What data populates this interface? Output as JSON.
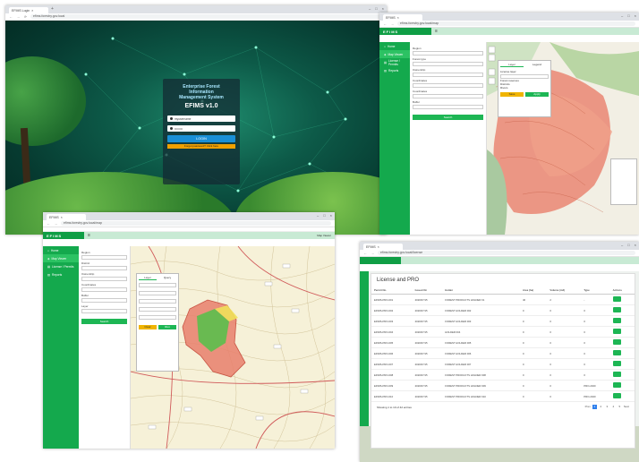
{
  "windows": {
    "login": {
      "tab_title": "EFIMS Login",
      "url": "efims.forestry.gov.local",
      "title_line1": "Enterprise Forest",
      "title_line2": "Information",
      "title_line3": "Management System",
      "version_title": "EFIMS v1.0",
      "username_value": "myusername",
      "password_value": "••••••••",
      "login_button": "LOGIN",
      "forgot_link": "Forgot password? Click here"
    },
    "map_right": {
      "tab_title": "EFIMS",
      "url": "efims.forestry.gov.local/map",
      "brand": "EFIMS",
      "sidebar": [
        "Home",
        "Map Viewer",
        "License / Permits",
        "Reports"
      ],
      "panel_labels": [
        "Region",
        "Forest type",
        "Ownership",
        "Coordinates",
        "Coordinates",
        "Buffer"
      ],
      "panel_button": "Search",
      "popup_tabs": [
        "Layer",
        "Legend"
      ],
      "popup_fields": [
        "License layer",
        "Forest reserves",
        "Districts",
        "Rivers"
      ],
      "popup_btn1": "Save",
      "popup_btn2": "Apply"
    },
    "map_left": {
      "tab_title": "EFIMS",
      "url": "efims.forestry.gov.local/map",
      "brand": "EFIMS",
      "sidebar": [
        "Home",
        "Map Viewer",
        "License / Permits",
        "Reports"
      ],
      "panel_labels": [
        "Region",
        "District",
        "Ownership",
        "Coordinates",
        "Buffer",
        "Layer"
      ],
      "panel_button": "Search",
      "popup_tabs": [
        "Layer",
        "Query"
      ],
      "popup_btn1": "Clear",
      "popup_btn2": "Run",
      "header_right": "Map Viewer"
    },
    "table": {
      "tab_title": "EFIMS",
      "url": "efims.forestry.gov.local/license",
      "title": "License and PRO",
      "columns": [
        "Permit No.",
        "Issued On",
        "Holder",
        "Area (ha)",
        "Volume (m3)",
        "Type",
        "Actions"
      ],
      "rows": [
        [
          "EFIMS-PRO-001",
          "2020/07/15",
          "FOREST PRODUCTS HOLDER 01",
          "40",
          "2",
          "-",
          ""
        ],
        [
          "EFIMS-PRO-002",
          "2020/07/15",
          "FOREST HOLDER 002",
          "0",
          "0",
          "0",
          ""
        ],
        [
          "EFIMS-PRO-003",
          "2020/07/15",
          "FOREST HOLDER 003",
          "0",
          "0",
          "0",
          ""
        ],
        [
          "EFIMS-PRO-004",
          "2020/07/15",
          "HOLDER 004",
          "0",
          "0",
          "0",
          ""
        ],
        [
          "EFIMS-PRO-005",
          "2020/07/15",
          "FOREST HOLDER 005",
          "0",
          "0",
          "0",
          ""
        ],
        [
          "EFIMS-PRO-006",
          "2020/07/15",
          "FOREST HOLDER 006",
          "0",
          "0",
          "0",
          ""
        ],
        [
          "EFIMS-PRO-007",
          "2020/07/15",
          "FOREST HOLDER 007",
          "0",
          "0",
          "0",
          ""
        ],
        [
          "EFIMS-PRO-008",
          "2020/07/15",
          "FOREST PRODUCTS HOLDER 008",
          "0",
          "0",
          "0",
          ""
        ],
        [
          "EFIMS-PRO-009",
          "2020/07/15",
          "FOREST PRODUCTS HOLDER 009",
          "0",
          "0",
          "PRO-2020",
          ""
        ],
        [
          "EFIMS-PRO-010",
          "2020/07/15",
          "FOREST PRODUCTS HOLDER 010",
          "0",
          "0",
          "PRO-2020",
          ""
        ]
      ],
      "footer_text": "Showing 1 to 10 of 42 entries",
      "pager": [
        "Prev",
        "1",
        "2",
        "3",
        "4",
        "5",
        "Next"
      ]
    }
  },
  "colors": {
    "brand_green": "#0f9e45",
    "sidebar_green": "#14a94d",
    "accent_blue": "#1a8fd6",
    "map_red": "#e9806c",
    "map_highlight": "#5bbf4d"
  }
}
